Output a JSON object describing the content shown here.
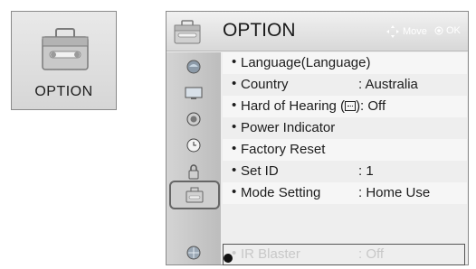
{
  "tile": {
    "label": "OPTION",
    "icon": "toolbox-icon"
  },
  "panel": {
    "title": "OPTION",
    "hints": {
      "move": "Move",
      "ok": "OK"
    },
    "icons": [
      "picture-icon",
      "screen-icon",
      "audio-icon",
      "clock-icon",
      "lock-icon",
      "toolbox-icon",
      "network-icon"
    ],
    "selected_icon": "toolbox-icon",
    "items": [
      {
        "label": "Language(Language)",
        "value": ""
      },
      {
        "label": "Country",
        "value": ": Australia"
      },
      {
        "label": "Hard of Hearing (",
        "cc": "subtitle-icon",
        "suffix": "): Off",
        "value": ""
      },
      {
        "label": "Power Indicator",
        "value": ""
      },
      {
        "label": "Factory Reset",
        "value": ""
      },
      {
        "label": "Set ID",
        "value": ": 1"
      },
      {
        "label": "Mode Setting",
        "value": ": Home Use"
      },
      {
        "label": "IR Blaster",
        "value": ": Off",
        "disabled": true
      }
    ],
    "bullet": "•"
  },
  "colors": {
    "panel_bg": "#eeeeee",
    "header_top": "#f1f1f1",
    "header_bottom": "#d8d8d8",
    "disabled_text": "#c8c8c8"
  }
}
